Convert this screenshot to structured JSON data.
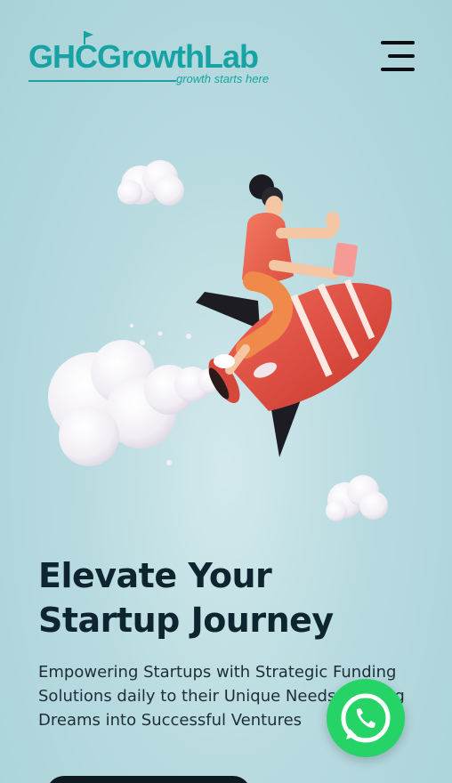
{
  "header": {
    "logo_text": "GHCGrowthLab",
    "logo_tagline": "growth starts here",
    "menu_icon": "hamburger-icon"
  },
  "hero": {
    "illustration": "rocket-rider-illustration",
    "headline": "Elevate Your Startup Journey",
    "subtext": "Empowering Startups with Strategic Funding Solutions daily to their Unique Needs, Turning Dreams into Successful Ventures"
  },
  "floating": {
    "whatsapp_icon": "whatsapp-icon"
  },
  "colors": {
    "brand": "#17a3a3",
    "background": "#b8dbe0",
    "headline": "#0e2530",
    "whatsapp": "#25d366",
    "rocket": "#e8473b"
  }
}
